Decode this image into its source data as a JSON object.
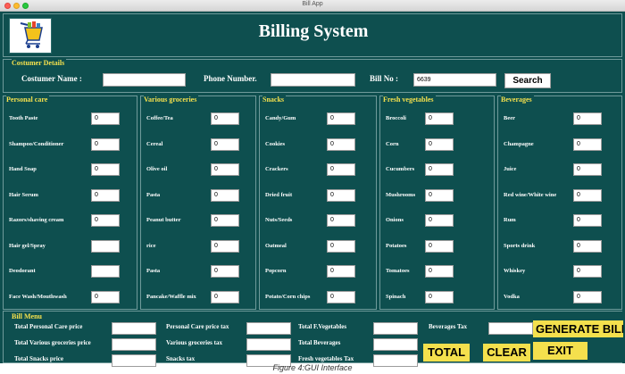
{
  "window": {
    "title": "Bill App"
  },
  "header": {
    "title": "Billing System",
    "logo_icon": "shopping-cart-icon"
  },
  "customer": {
    "frame_title": "Costumer Details",
    "name_label": "Costumer Name :",
    "name_value": "",
    "phone_label": "Phone Number.",
    "phone_value": "",
    "bill_label": "Bill No :",
    "bill_value": "6639",
    "search_label": "Search"
  },
  "categories": [
    {
      "title": "Personal care",
      "items": [
        {
          "label": "Tooth Paste",
          "qty": "0"
        },
        {
          "label": "Shampoo/Conditioner",
          "qty": "0"
        },
        {
          "label": "Hand Soap",
          "qty": "0"
        },
        {
          "label": "Hair Serum",
          "qty": "0"
        },
        {
          "label": "Razors/shaving cream",
          "qty": "0"
        },
        {
          "label": "Hair gel/Spray",
          "qty": ""
        },
        {
          "label": "Deodorant",
          "qty": ""
        },
        {
          "label": "Face Wash/Mouthwash",
          "qty": "0"
        }
      ]
    },
    {
      "title": "Various groceries",
      "items": [
        {
          "label": "Coffee/Tea",
          "qty": "0"
        },
        {
          "label": "Cereal",
          "qty": "0"
        },
        {
          "label": "Olive oil",
          "qty": "0"
        },
        {
          "label": "Pasta",
          "qty": "0"
        },
        {
          "label": "Peanut butter",
          "qty": "0"
        },
        {
          "label": "rice",
          "qty": "0"
        },
        {
          "label": "Pasta",
          "qty": "0"
        },
        {
          "label": "Pancake/Waffle mix",
          "qty": "0"
        }
      ]
    },
    {
      "title": "Snacks",
      "items": [
        {
          "label": "Candy/Gum",
          "qty": "0"
        },
        {
          "label": "Cookies",
          "qty": "0"
        },
        {
          "label": "Crackers",
          "qty": "0"
        },
        {
          "label": "Dried fruit",
          "qty": "0"
        },
        {
          "label": "Nuts/Seeds",
          "qty": "0"
        },
        {
          "label": "Oatmeal",
          "qty": "0"
        },
        {
          "label": "Popcorn",
          "qty": "0"
        },
        {
          "label": "Potato/Corn chips",
          "qty": "0"
        }
      ]
    },
    {
      "title": "Fresh vegetables",
      "items": [
        {
          "label": "Broccoli",
          "qty": "0"
        },
        {
          "label": "Corn",
          "qty": "0"
        },
        {
          "label": "Cucumbers",
          "qty": "0"
        },
        {
          "label": "Mushrooms",
          "qty": "0"
        },
        {
          "label": "Onions",
          "qty": "0"
        },
        {
          "label": "Potatoes",
          "qty": "0"
        },
        {
          "label": "Tomatoes",
          "qty": "0"
        },
        {
          "label": "Spinach",
          "qty": "0"
        }
      ]
    },
    {
      "title": "Beverages",
      "items": [
        {
          "label": "Beer",
          "qty": "0"
        },
        {
          "label": "Champagne",
          "qty": "0"
        },
        {
          "label": "Juice",
          "qty": "0"
        },
        {
          "label": "Red wine/White wine",
          "qty": "0"
        },
        {
          "label": "Rum",
          "qty": "0"
        },
        {
          "label": "Sports drink",
          "qty": "0"
        },
        {
          "label": "Whiskey",
          "qty": "0"
        },
        {
          "label": "Vodka",
          "qty": "0"
        }
      ]
    }
  ],
  "bill_menu": {
    "title": "Bill Menu",
    "total_personal_care": "Total Personal Care price",
    "total_various": "Total Various groceries price",
    "total_snacks": "Total Snacks price",
    "personal_tax": "Personal Care price  tax",
    "various_tax": "Various groceries tax",
    "snacks_tax": "Snacks  tax",
    "total_fveg": "Total F.Vegetables",
    "total_beverages": "Total Beverages",
    "fveg_tax": "Fresh vegetables Tax",
    "beverages_tax": "Beverages  Tax",
    "generate_bill": "GENERATE BILL",
    "total": "TOTAL",
    "clear": "CLEAR",
    "exit": "EXIT"
  },
  "caption": "Figure 4:GUI Interface",
  "colors": {
    "background": "#0e4f4f",
    "accent": "#f4e04d",
    "text": "#ffffff"
  }
}
